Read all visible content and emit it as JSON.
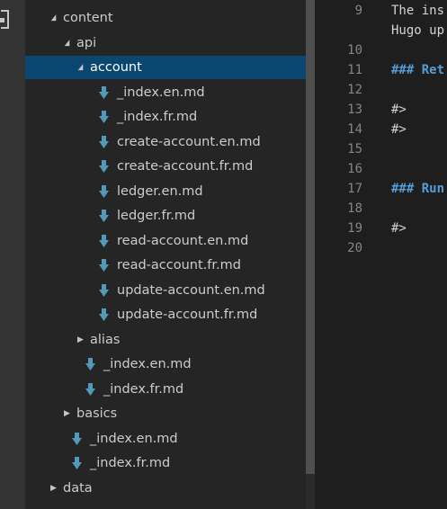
{
  "explorer": {
    "items": [
      {
        "label": "content",
        "kind": "folder",
        "open": true,
        "depth": 0
      },
      {
        "label": "api",
        "kind": "folder",
        "open": true,
        "depth": 1
      },
      {
        "label": "account",
        "kind": "folder",
        "open": true,
        "depth": 2,
        "selected": true
      },
      {
        "label": "_index.en.md",
        "kind": "file",
        "depth": 3
      },
      {
        "label": "_index.fr.md",
        "kind": "file",
        "depth": 3
      },
      {
        "label": "create-account.en.md",
        "kind": "file",
        "depth": 3
      },
      {
        "label": "create-account.fr.md",
        "kind": "file",
        "depth": 3
      },
      {
        "label": "ledger.en.md",
        "kind": "file",
        "depth": 3
      },
      {
        "label": "ledger.fr.md",
        "kind": "file",
        "depth": 3
      },
      {
        "label": "read-account.en.md",
        "kind": "file",
        "depth": 3
      },
      {
        "label": "read-account.fr.md",
        "kind": "file",
        "depth": 3
      },
      {
        "label": "update-account.en.md",
        "kind": "file",
        "depth": 3
      },
      {
        "label": "update-account.fr.md",
        "kind": "file",
        "depth": 3
      },
      {
        "label": "alias",
        "kind": "folder",
        "open": false,
        "depth": 2
      },
      {
        "label": "_index.en.md",
        "kind": "file",
        "depth": 2
      },
      {
        "label": "_index.fr.md",
        "kind": "file",
        "depth": 2
      },
      {
        "label": "basics",
        "kind": "folder",
        "open": false,
        "depth": 1
      },
      {
        "label": "_index.en.md",
        "kind": "file",
        "depth": 1
      },
      {
        "label": "_index.fr.md",
        "kind": "file",
        "depth": 1
      },
      {
        "label": "data",
        "kind": "folder",
        "open": false,
        "depth": 0
      }
    ],
    "icons": {
      "folder_open": "chevron-down-icon",
      "folder_closed": "chevron-right-icon",
      "file": "markdown-download-arrow-icon"
    },
    "colors": {
      "selected_bg": "#094771",
      "file_icon": "#519aba",
      "text": "#cccccc"
    }
  },
  "editor": {
    "lines": [
      {
        "num": "9",
        "text": "The ins",
        "style": "normal"
      },
      {
        "num": "",
        "text": "Hugo up",
        "style": "normal"
      },
      {
        "num": "10",
        "text": "",
        "style": "normal"
      },
      {
        "num": "11",
        "text": "### Ret",
        "style": "heading"
      },
      {
        "num": "12",
        "text": "",
        "style": "normal"
      },
      {
        "num": "13",
        "text": "    #>",
        "style": "normal"
      },
      {
        "num": "14",
        "text": "    #>",
        "style": "normal"
      },
      {
        "num": "15",
        "text": "",
        "style": "normal"
      },
      {
        "num": "16",
        "text": "",
        "style": "normal"
      },
      {
        "num": "17",
        "text": "### Run",
        "style": "heading"
      },
      {
        "num": "18",
        "text": "",
        "style": "normal"
      },
      {
        "num": "19",
        "text": "    #>",
        "style": "normal"
      },
      {
        "num": "20",
        "text": "",
        "style": "normal"
      }
    ],
    "colors": {
      "line_number": "#858585",
      "text": "#d4d4d4",
      "heading": "#569cd6"
    }
  }
}
